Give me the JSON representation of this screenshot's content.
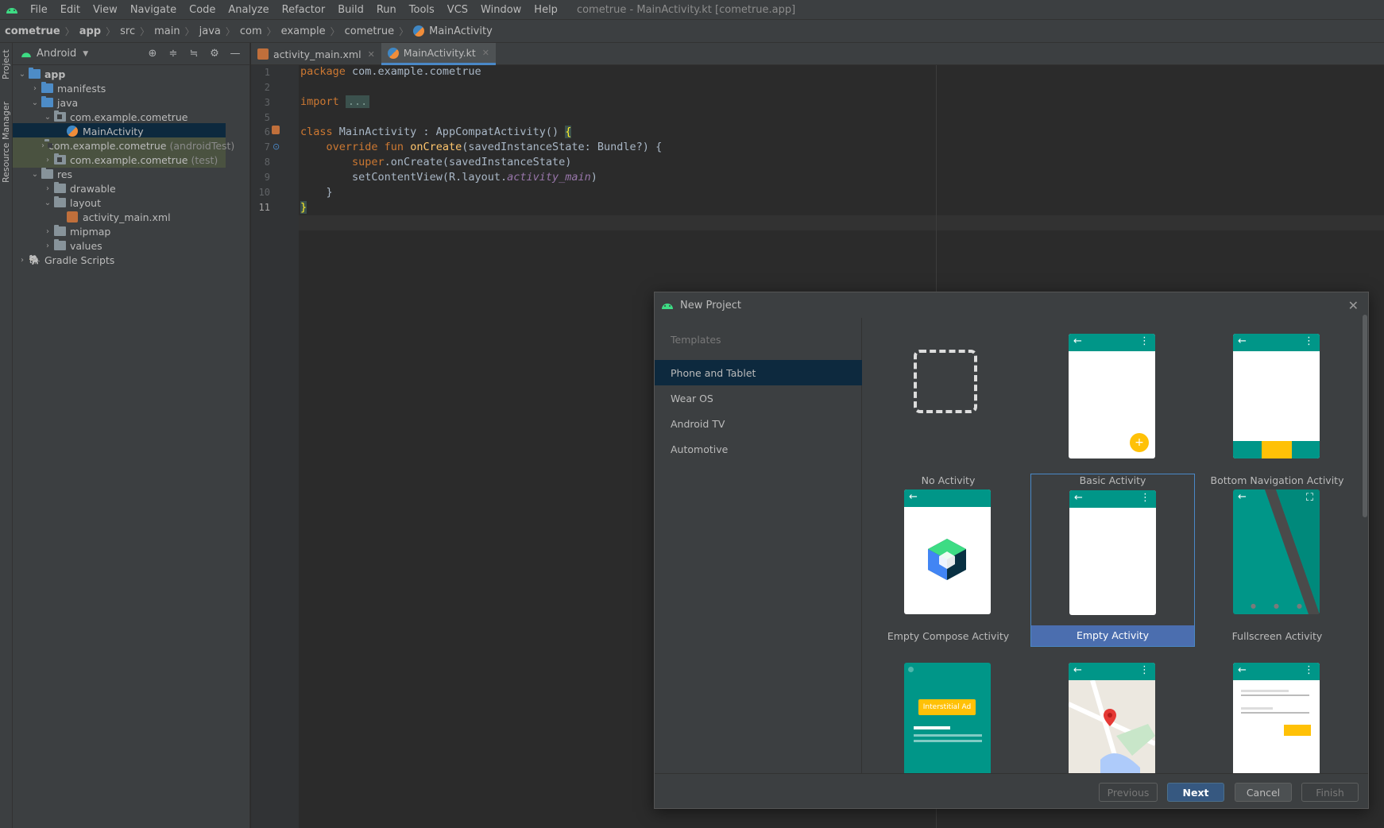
{
  "app": {
    "window_title": "cometrue - MainActivity.kt [cometrue.app]",
    "menu": [
      "File",
      "Edit",
      "View",
      "Navigate",
      "Code",
      "Analyze",
      "Refactor",
      "Build",
      "Run",
      "Tools",
      "VCS",
      "Window",
      "Help"
    ]
  },
  "breadcrumb": [
    "cometrue",
    "app",
    "src",
    "main",
    "java",
    "com",
    "example",
    "cometrue",
    "MainActivity"
  ],
  "toolstrip": {
    "project_label": "Project",
    "resource_label": "Resource Manager"
  },
  "project_panel": {
    "view_name": "Android",
    "tree": [
      {
        "label": "app",
        "depth": 0
      },
      {
        "label": "manifests",
        "depth": 1
      },
      {
        "label": "java",
        "depth": 1
      },
      {
        "label": "com.example.cometrue",
        "depth": 2
      },
      {
        "label": "MainActivity",
        "depth": 3
      },
      {
        "label": "com.example.cometrue",
        "suffix": "(androidTest)",
        "depth": 2
      },
      {
        "label": "com.example.cometrue",
        "suffix": "(test)",
        "depth": 2
      },
      {
        "label": "res",
        "depth": 1
      },
      {
        "label": "drawable",
        "depth": 2
      },
      {
        "label": "layout",
        "depth": 2
      },
      {
        "label": "activity_main.xml",
        "depth": 3
      },
      {
        "label": "mipmap",
        "depth": 2
      },
      {
        "label": "values",
        "depth": 2
      },
      {
        "label": "Gradle Scripts",
        "depth": 0
      }
    ]
  },
  "editor": {
    "tabs": [
      {
        "label": "activity_main.xml",
        "active": false
      },
      {
        "label": "MainActivity.kt",
        "active": true
      }
    ],
    "line_numbers": [
      "1",
      "2",
      "3",
      "5",
      "6",
      "7",
      "8",
      "9",
      "10",
      "11"
    ],
    "code": {
      "l1_kw": "package",
      "l1_rest": " com.example.cometrue",
      "l3_kw": "import",
      "l3_fold": "...",
      "l6_kw": "class",
      "l6_rest": " MainActivity : AppCompatActivity() ",
      "l6_brace": "{",
      "l7_kw": "override fun",
      "l7_fn": "onCreate",
      "l7_rest": "(savedInstanceState: Bundle?) {",
      "l8_kw": "super",
      "l8_rest": ".onCreate(savedInstanceState)",
      "l9_pre": "setContentView(R.layout.",
      "l9_it": "activity_main",
      "l9_post": ")",
      "l10": "}",
      "l11_brace": "}"
    }
  },
  "dialog": {
    "title": "New Project",
    "section_label": "Templates",
    "categories": [
      "Phone and Tablet",
      "Wear OS",
      "Android TV",
      "Automotive"
    ],
    "selected_category": "Phone and Tablet",
    "templates": [
      "No Activity",
      "Basic Activity",
      "Bottom Navigation Activity",
      "Empty Compose Activity",
      "Empty Activity",
      "Fullscreen Activity"
    ],
    "selected_template": "Empty Activity",
    "ad_banner_text": "Interstitial Ad",
    "buttons": {
      "previous": "Previous",
      "next": "Next",
      "cancel": "Cancel",
      "finish": "Finish"
    }
  },
  "colors": {
    "accent": "#4a88c7",
    "teal": "#009688",
    "selection": "#0d293e",
    "primary_button": "#365880",
    "amber": "#ffc107"
  }
}
